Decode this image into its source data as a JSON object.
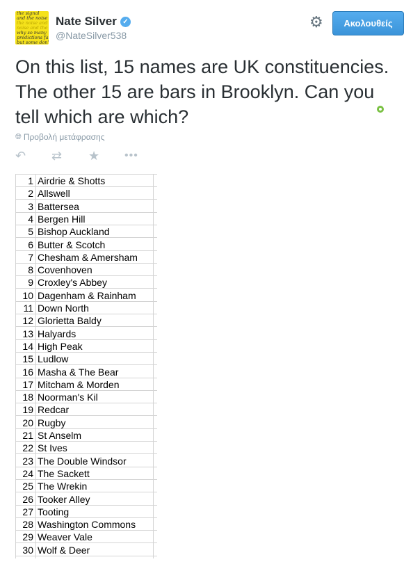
{
  "profile": {
    "name": "Nate Silver",
    "handle": "@NateSilver538",
    "avatar_lines": [
      "the signal",
      "and the noise",
      "the noise and the",
      "noise and the",
      "why so many",
      "predictions fail–",
      "but some don't"
    ],
    "verified_icon": "check-icon"
  },
  "header": {
    "settings_icon": "gear-icon",
    "follow_label": "Ακολουθείς"
  },
  "tweet": {
    "text": "On this list, 15 names are UK constituencies. The other 15 are bars in Brooklyn. Can you tell which are which?",
    "translate_label": "Προβολή μετάφρασης"
  },
  "actions": {
    "reply_icon": "reply-icon",
    "retweet_icon": "retweet-icon",
    "favorite_icon": "star-icon",
    "more_icon": "more-icon"
  },
  "list": [
    {
      "num": "1",
      "name": "Airdrie & Shotts"
    },
    {
      "num": "2",
      "name": "Allswell"
    },
    {
      "num": "3",
      "name": "Battersea"
    },
    {
      "num": "4",
      "name": "Bergen Hill"
    },
    {
      "num": "5",
      "name": "Bishop Auckland"
    },
    {
      "num": "6",
      "name": "Butter & Scotch"
    },
    {
      "num": "7",
      "name": "Chesham & Amersham"
    },
    {
      "num": "8",
      "name": "Covenhoven"
    },
    {
      "num": "9",
      "name": "Croxley's Abbey"
    },
    {
      "num": "10",
      "name": "Dagenham & Rainham"
    },
    {
      "num": "11",
      "name": "Down North"
    },
    {
      "num": "12",
      "name": "Glorietta Baldy"
    },
    {
      "num": "13",
      "name": "Halyards"
    },
    {
      "num": "14",
      "name": "High Peak"
    },
    {
      "num": "15",
      "name": "Ludlow"
    },
    {
      "num": "16",
      "name": "Masha & The Bear"
    },
    {
      "num": "17",
      "name": "Mitcham & Morden"
    },
    {
      "num": "18",
      "name": "Noorman's Kil"
    },
    {
      "num": "19",
      "name": "Redcar"
    },
    {
      "num": "20",
      "name": "Rugby"
    },
    {
      "num": "21",
      "name": "St Anselm"
    },
    {
      "num": "22",
      "name": "St Ives"
    },
    {
      "num": "23",
      "name": "The Double Windsor"
    },
    {
      "num": "24",
      "name": "The Sackett"
    },
    {
      "num": "25",
      "name": "The Wrekin"
    },
    {
      "num": "26",
      "name": "Tooker Alley"
    },
    {
      "num": "27",
      "name": "Tooting"
    },
    {
      "num": "28",
      "name": "Washington Commons"
    },
    {
      "num": "29",
      "name": "Weaver Vale"
    },
    {
      "num": "30",
      "name": "Wolf & Deer"
    }
  ],
  "colors": {
    "follow_button": "#55acee",
    "text": "#292f33",
    "muted": "#8899a6"
  }
}
